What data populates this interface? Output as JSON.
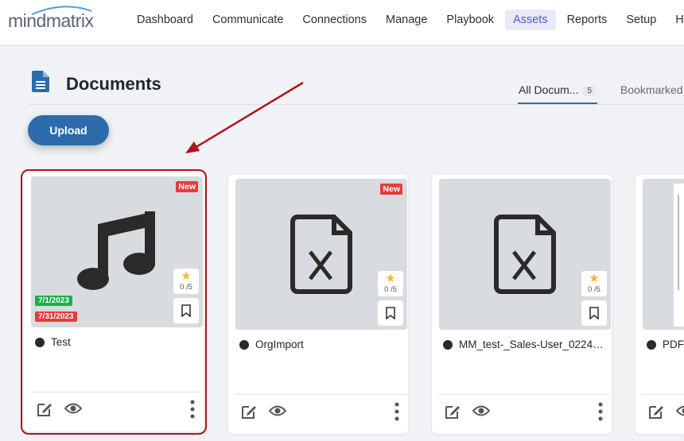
{
  "app": {
    "logo_text": "mindmatrix"
  },
  "nav": {
    "items": [
      {
        "label": "Dashboard"
      },
      {
        "label": "Communicate"
      },
      {
        "label": "Connections"
      },
      {
        "label": "Manage"
      },
      {
        "label": "Playbook"
      },
      {
        "label": "Assets",
        "active": true
      },
      {
        "label": "Reports"
      },
      {
        "label": "Setup"
      },
      {
        "label": "Help"
      }
    ]
  },
  "page": {
    "title": "Documents",
    "tabs": {
      "all_label": "All Docum...",
      "all_count": "5",
      "bookmarked_label": "Bookmarked"
    },
    "upload_label": "Upload"
  },
  "cards": [
    {
      "name": "Test",
      "badge": "New",
      "rating": "0 /5",
      "date_start": "7/1/2023",
      "date_end": "7/31/2023",
      "thumb_icon": "music-note-icon"
    },
    {
      "name": "OrgImport",
      "badge": "New",
      "rating": "0 /5",
      "thumb_icon": "excel-file-icon"
    },
    {
      "name": "MM_test-_Sales-User_02242...",
      "rating": "0 /5",
      "thumb_icon": "excel-file-icon"
    },
    {
      "name": "PDF",
      "thumb_icon": "pdf-preview-icon"
    }
  ],
  "colors": {
    "accent": "#2d6bab",
    "nav_active": "#4f5bd5",
    "new_badge": "#e63c3c",
    "start_date": "#19b04a",
    "selection_outline": "#b0141c"
  }
}
